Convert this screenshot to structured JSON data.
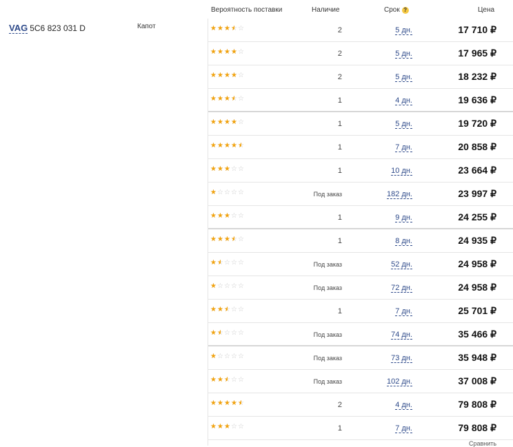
{
  "header": {
    "probability": "Вероятность поставки",
    "availability": "Наличие",
    "term": "Срок",
    "term_help": "?",
    "price": "Цена"
  },
  "part": {
    "brand": "VAG",
    "number": "5C6 823 031 D",
    "name": "Капот"
  },
  "offers": [
    {
      "rating": 3.5,
      "availability": "2",
      "term": "5 дн.",
      "price": "17 710 ₽"
    },
    {
      "rating": 4,
      "availability": "2",
      "term": "5 дн.",
      "price": "17 965 ₽"
    },
    {
      "rating": 4,
      "availability": "2",
      "term": "5 дн.",
      "price": "18 232 ₽"
    },
    {
      "rating": 3.5,
      "availability": "1",
      "term": "4 дн.",
      "price": "19 636 ₽"
    },
    {
      "rating": 4,
      "availability": "1",
      "term": "5 дн.",
      "price": "19 720 ₽"
    },
    {
      "rating": 4.5,
      "availability": "1",
      "term": "7 дн.",
      "price": "20 858 ₽"
    },
    {
      "rating": 3,
      "availability": "1",
      "term": "10 дн.",
      "price": "23 664 ₽"
    },
    {
      "rating": 1,
      "availability": "Под заказ",
      "term": "182 дн.",
      "price": "23 997 ₽"
    },
    {
      "rating": 3,
      "availability": "1",
      "term": "9 дн.",
      "price": "24 255 ₽"
    },
    {
      "rating": 3.5,
      "availability": "1",
      "term": "8 дн.",
      "price": "24 935 ₽"
    },
    {
      "rating": 1.5,
      "availability": "Под заказ",
      "term": "52 дн.",
      "price": "24 958 ₽"
    },
    {
      "rating": 1,
      "availability": "Под заказ",
      "term": "72 дн.",
      "price": "24 958 ₽"
    },
    {
      "rating": 2.5,
      "availability": "1",
      "term": "7 дн.",
      "price": "25 701 ₽"
    },
    {
      "rating": 1.5,
      "availability": "Под заказ",
      "term": "74 дн.",
      "price": "35 466 ₽"
    },
    {
      "rating": 1,
      "availability": "Под заказ",
      "term": "73 дн.",
      "price": "35 948 ₽"
    },
    {
      "rating": 2.5,
      "availability": "Под заказ",
      "term": "102 дн.",
      "price": "37 008 ₽"
    },
    {
      "rating": 4.5,
      "availability": "2",
      "term": "4 дн.",
      "price": "79 808 ₽"
    },
    {
      "rating": 3,
      "availability": "1",
      "term": "7 дн.",
      "price": "79 808 ₽"
    }
  ],
  "footer": {
    "compare": "Сравнить"
  },
  "colors": {
    "star_filled": "#f2a20c",
    "star_empty": "#c8c8c8",
    "link": "#2e4a8a"
  }
}
